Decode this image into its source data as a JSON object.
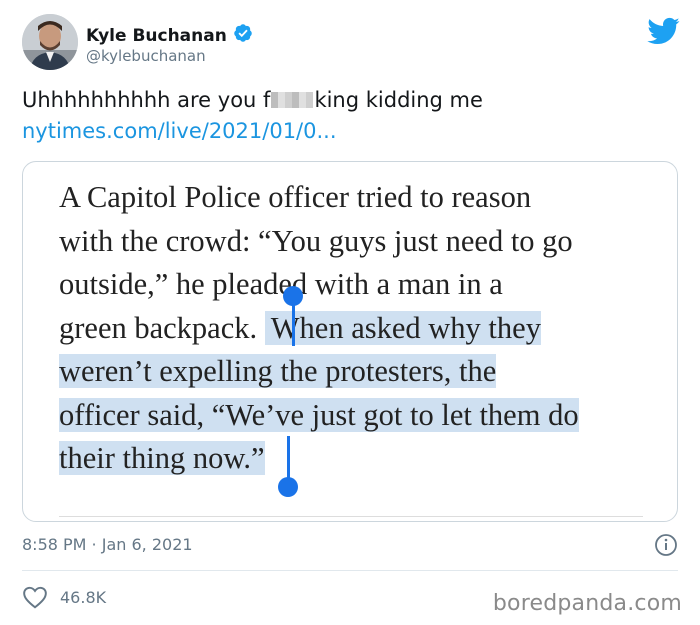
{
  "tweet": {
    "author": {
      "display_name": "Kyle Buchanan",
      "handle": "@kylebuchanan",
      "verified": true
    },
    "text_before_censor": "Uhhhhhhhhhh are you f",
    "text_after_censor": "king kidding me",
    "link_text": "nytimes.com/live/2021/01/0...",
    "timestamp": "8:58 PM · Jan 6, 2021",
    "likes": "46.8K"
  },
  "article_snippet": {
    "lines": [
      {
        "plain": "A Capitol Police officer tried to reason",
        "highlight": ""
      },
      {
        "plain": "with the crowd: “You guys just need to go",
        "highlight": ""
      },
      {
        "plain": "outside,” he pleaded with a man in a",
        "highlight": ""
      },
      {
        "plain": "green backpack.",
        "highlight": "When asked why they"
      },
      {
        "plain": "",
        "highlight": "weren’t expelling the protesters, the"
      },
      {
        "plain": "",
        "highlight": "officer said, “We’ve just got to let them do"
      },
      {
        "plain": "",
        "highlight": "their thing now.”"
      }
    ]
  },
  "watermark": "boredpanda.com",
  "colors": {
    "twitter_blue": "#1da1f2",
    "link_blue": "#1b95e0",
    "selection_highlight": "#cfe0f1",
    "selection_handle": "#1a73e8",
    "muted_text": "#657786"
  },
  "icons": {
    "verified": "verified-badge-icon",
    "brand": "twitter-bird-icon",
    "info": "info-icon",
    "like": "heart-icon"
  }
}
